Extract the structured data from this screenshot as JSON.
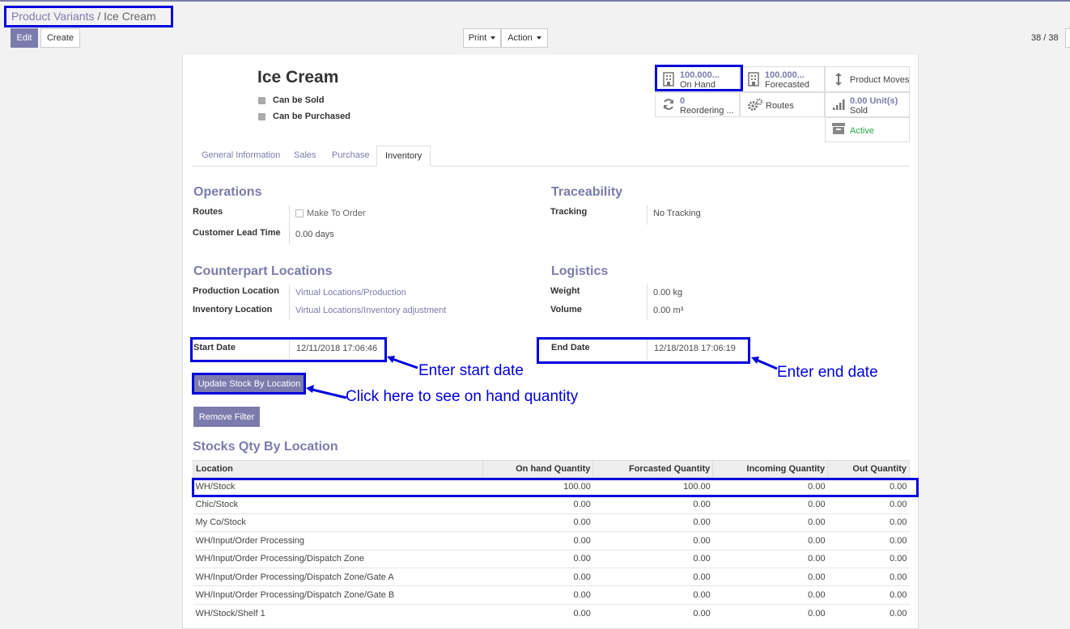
{
  "breadcrumb": {
    "parent": "Product Variants",
    "separator": " / ",
    "current": "Ice Cream"
  },
  "toolbar": {
    "edit": "Edit",
    "create": "Create",
    "print": "Print",
    "action": "Action",
    "pager": "38 / 38"
  },
  "product": {
    "name": "Ice Cream",
    "can_be_sold": "Can be Sold",
    "can_be_purchased": "Can be Purchased"
  },
  "smart_buttons": {
    "on_hand_value": "100.000...",
    "on_hand_label": "On Hand",
    "forecasted_value": "100.000...",
    "forecasted_label": "Forecasted",
    "product_moves": "Product Moves",
    "reordering_value": "0",
    "reordering_label": "Reordering ...",
    "routes": "Routes",
    "sold_value": "0.00  Unit(s)",
    "sold_label": "Sold",
    "active": "Active"
  },
  "tabs": [
    "General Information",
    "Sales",
    "Purchase",
    "Inventory"
  ],
  "operations": {
    "title": "Operations",
    "routes_label": "Routes",
    "make_to_order": "Make To Order",
    "lead_label": "Customer Lead Time",
    "lead_value": "0.00 days"
  },
  "traceability": {
    "title": "Traceability",
    "tracking_label": "Tracking",
    "tracking_value": "No Tracking"
  },
  "counterpart": {
    "title": "Counterpart Locations",
    "production_label": "Production Location",
    "production_value": "Virtual Locations/Production",
    "inventory_label": "Inventory Location",
    "inventory_value": "Virtual Locations/Inventory adjustment"
  },
  "logistics": {
    "title": "Logistics",
    "weight_label": "Weight",
    "weight_value": "0.00 kg",
    "volume_label": "Volume",
    "volume_value": "0.00 m³"
  },
  "dates": {
    "start_label": "Start Date",
    "start_value": "12/11/2018 17:06:46",
    "end_label": "End Date",
    "end_value": "12/18/2018 17:06:19"
  },
  "actions": {
    "update": "Update Stock By Location",
    "remove": "Remove Filter"
  },
  "annotations": {
    "start": "Enter start date",
    "end": "Enter end date",
    "update": "Click here to see on hand quantity"
  },
  "stock": {
    "title": "Stocks Qty By Location",
    "headers": [
      "Location",
      "On hand Quantity",
      "Forcasted Quantity",
      "Incoming Quantity",
      "Out Quantity"
    ],
    "rows": [
      [
        "WH/Stock",
        "100.00",
        "100.00",
        "0.00",
        "0.00"
      ],
      [
        "Chic/Stock",
        "0.00",
        "0.00",
        "0.00",
        "0.00"
      ],
      [
        "My Co/Stock",
        "0.00",
        "0.00",
        "0.00",
        "0.00"
      ],
      [
        "WH/Input/Order Processing",
        "0.00",
        "0.00",
        "0.00",
        "0.00"
      ],
      [
        "WH/Input/Order Processing/Dispatch Zone",
        "0.00",
        "0.00",
        "0.00",
        "0.00"
      ],
      [
        "WH/Input/Order Processing/Dispatch Zone/Gate A",
        "0.00",
        "0.00",
        "0.00",
        "0.00"
      ],
      [
        "WH/Input/Order Processing/Dispatch Zone/Gate B",
        "0.00",
        "0.00",
        "0.00",
        "0.00"
      ],
      [
        "WH/Stock/Shelf 1",
        "0.00",
        "0.00",
        "0.00",
        "0.00"
      ]
    ]
  },
  "colors": {
    "accent": "#7c7bad",
    "annotation": "#0000dd",
    "active": "#28a745"
  }
}
